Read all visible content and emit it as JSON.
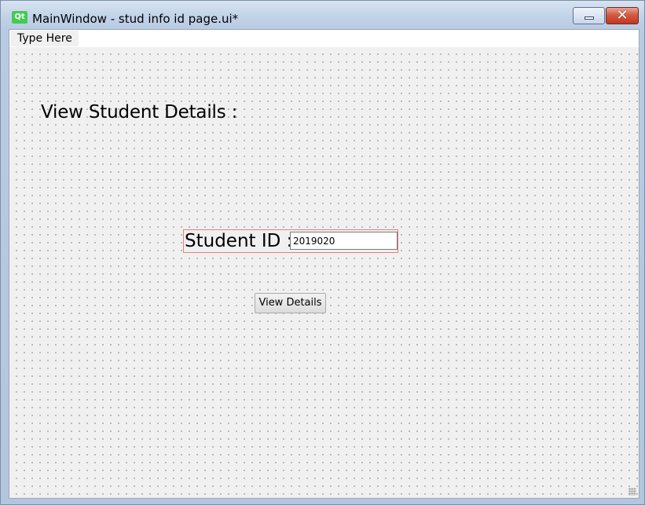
{
  "window": {
    "title": "MainWindow - stud info id page.ui*",
    "app_icon_text": "Qt",
    "minimize_glyph": "",
    "close_glyph": "✕"
  },
  "menubar": {
    "items": [
      {
        "label": "Type Here"
      }
    ]
  },
  "form": {
    "heading": "View Student Details :",
    "student_id_label": "Student ID :",
    "student_id_value": "2019020",
    "view_button_label": "View Details"
  },
  "colors": {
    "qt_green": "#41cd52",
    "close_red": "#c1371f",
    "selection_border": "#e88080",
    "canvas_bg": "#f0f0f0"
  }
}
